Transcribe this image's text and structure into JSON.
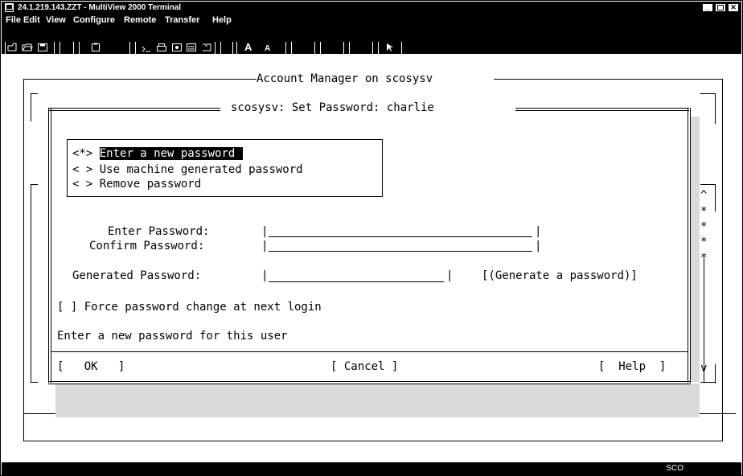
{
  "window": {
    "title": "24.1.219.143.ZZT - MultiView 2000 Terminal"
  },
  "menu": [
    {
      "label": "File"
    },
    {
      "label": "Edit"
    },
    {
      "label": "View"
    },
    {
      "label": "Configure"
    },
    {
      "label": "Remote"
    },
    {
      "label": "Transfer"
    },
    {
      "label": "Help"
    }
  ],
  "toolbar": {
    "font_large": "A",
    "font_small": "A"
  },
  "terminal": {
    "outer_title": "Account Manager on scosysv",
    "dialog_title": "scosysv: Set Password: charlie",
    "options": [
      {
        "mark": "<*>",
        "label": "Enter a new password",
        "selected": true
      },
      {
        "mark": "< >",
        "label": "Use machine generated password",
        "selected": false
      },
      {
        "mark": "< >",
        "label": "Remove password",
        "selected": false
      }
    ],
    "enter_password_label": "Enter Password:",
    "confirm_password_label": "Confirm Password:",
    "generated_password_label": "Generated Password:",
    "generate_button": "[(Generate a password)]",
    "force_change": "[ ] Force password change at next login",
    "hint": "Enter a new password for this user",
    "ok_button": "[   OK   ]",
    "cancel_button": "[ Cancel ]",
    "help_button": "[  Help  ]",
    "scroll_up": "^",
    "scroll_down": "v",
    "scroll_stars": [
      "*",
      "*",
      "*",
      "*"
    ]
  },
  "status": {
    "text": "SCO"
  }
}
